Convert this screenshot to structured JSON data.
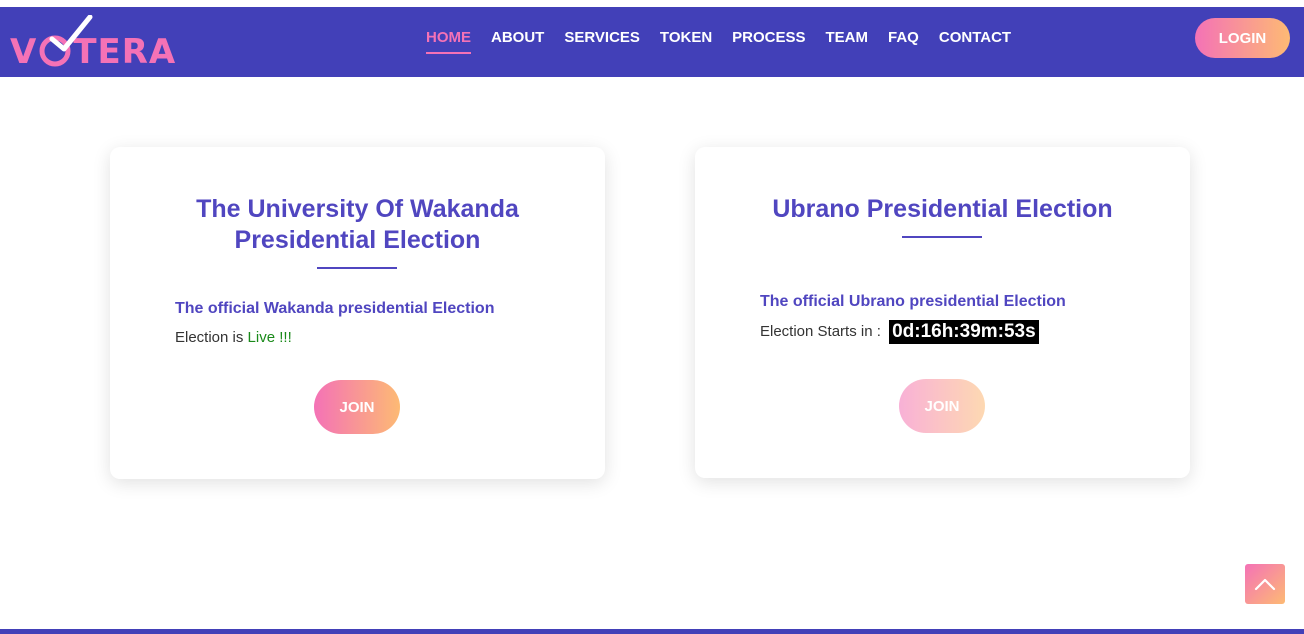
{
  "header": {
    "logo_text_prefix": "V",
    "logo_text_suffix": "TERA",
    "logo_icon": "checkmark-icon",
    "nav": [
      {
        "label": "HOME",
        "active": true
      },
      {
        "label": "ABOUT",
        "active": false
      },
      {
        "label": "SERVICES",
        "active": false
      },
      {
        "label": "TOKEN",
        "active": false
      },
      {
        "label": "PROCESS",
        "active": false
      },
      {
        "label": "TEAM",
        "active": false
      },
      {
        "label": "FAQ",
        "active": false
      },
      {
        "label": "CONTACT",
        "active": false
      }
    ],
    "login_label": "LOGIN"
  },
  "elections": [
    {
      "title": "The University Of Wakanda Presidential Election",
      "subtitle": "The official Wakanda presidential Election",
      "status_prefix": "Election is ",
      "status_value": "Live !!!",
      "join_label": "JOIN"
    },
    {
      "title": "Ubrano Presidential Election",
      "subtitle": "The official Ubrano presidential Election",
      "status_prefix": "Election Starts in : ",
      "countdown": "0d:16h:39m:53s",
      "join_label": "JOIN"
    }
  ],
  "scroll_top_icon": "chevron-up-icon",
  "colors": {
    "nav_bg": "#4240b8",
    "accent_pink": "#f472b6",
    "accent_orange": "#fdba74",
    "title_purple": "#5046c0",
    "live_green": "#1a8a1a"
  }
}
